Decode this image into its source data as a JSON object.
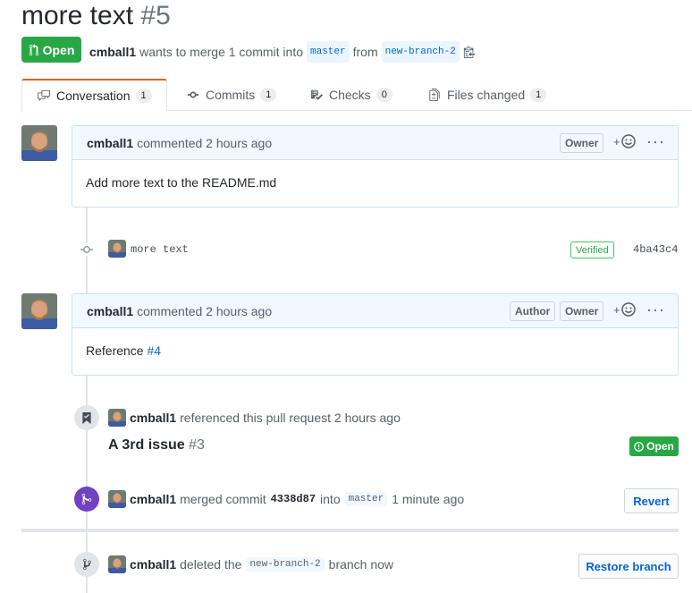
{
  "pr": {
    "title": "more text",
    "number": "#5",
    "state": "Open",
    "author": "cmball1",
    "merge_text": "wants to merge 1 commit into",
    "base_branch": "master",
    "from_text": "from",
    "head_branch": "new-branch-2"
  },
  "tabs": [
    {
      "label": "Conversation",
      "count": "1"
    },
    {
      "label": "Commits",
      "count": "1"
    },
    {
      "label": "Checks",
      "count": "0"
    },
    {
      "label": "Files changed",
      "count": "1"
    }
  ],
  "comment1": {
    "user": "cmball1",
    "action": "commented 2 hours ago",
    "badge_owner": "Owner",
    "body": "Add more text to the README.md",
    "react": "+",
    "more": "···"
  },
  "commit": {
    "message": "more text",
    "verified": "Verified",
    "sha": "4ba43c4"
  },
  "comment2": {
    "user": "cmball1",
    "action": "commented 2 hours ago",
    "badge_author": "Author",
    "badge_owner": "Owner",
    "body_text": "Reference",
    "body_link": "#4",
    "react": "+",
    "more": "···"
  },
  "reference": {
    "user": "cmball1",
    "text": "referenced this pull request 2 hours ago",
    "issue_title": "A 3rd issue",
    "issue_number": "#3",
    "issue_state": "Open"
  },
  "merged": {
    "user": "cmball1",
    "text1": "merged commit",
    "sha": "4338d87",
    "text2": "into",
    "branch": "master",
    "time": "1 minute ago",
    "revert_label": "Revert"
  },
  "deleted": {
    "user": "cmball1",
    "text1": "deleted the",
    "branch": "new-branch-2",
    "text2": "branch now",
    "restore_label": "Restore branch"
  },
  "colors": {
    "open_green": "#28a745",
    "merged_purple": "#6f42c1",
    "link_blue": "#0366d6",
    "comment_border": "#c8e1ff",
    "comment_header_bg": "#f1f8ff"
  }
}
